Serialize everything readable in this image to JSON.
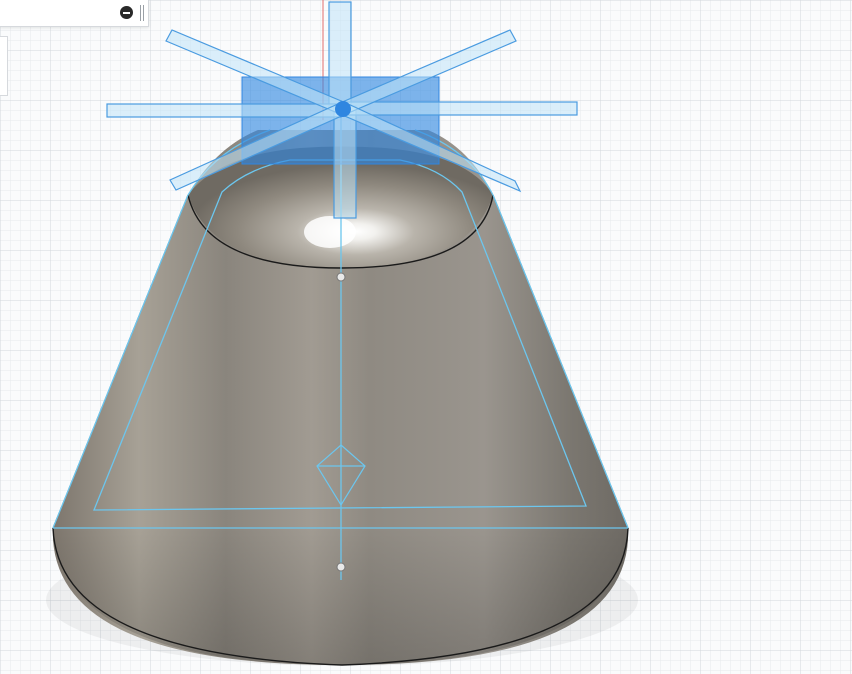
{
  "viewport": {
    "background": "#fafbfc",
    "grid_minor_color": "#e6e9ec",
    "grid_major_color": "#d2d7dc",
    "axis_color": "#e26c6c"
  },
  "model": {
    "shape": "truncated cone with spherical recess",
    "body_color": "#8c877f",
    "edge_color": "#1a1a1a"
  },
  "sketch": {
    "color": "#6cc6ee"
  },
  "gizmo": {
    "color": "#4a9be0",
    "fill": "#2f86e0"
  },
  "toolbar": {
    "collapse_icon": "minus-circle-icon",
    "grip_icon": "resize-grip-icon"
  }
}
